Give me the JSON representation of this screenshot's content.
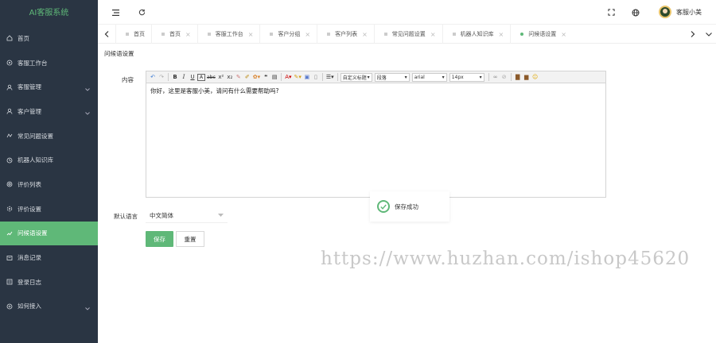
{
  "brand": "AI客服系统",
  "sidebar": {
    "items": [
      {
        "label": "首页",
        "icon": "home-icon",
        "chevron": false
      },
      {
        "label": "客服工作台",
        "icon": "workbench-icon",
        "chevron": false
      },
      {
        "label": "客服管理",
        "icon": "user-icon",
        "chevron": true
      },
      {
        "label": "客户管理",
        "icon": "user-icon",
        "chevron": true
      },
      {
        "label": "常见问题设置",
        "icon": "question-icon",
        "chevron": false
      },
      {
        "label": "机器人知识库",
        "icon": "robot-icon",
        "chevron": false
      },
      {
        "label": "评价列表",
        "icon": "rating-icon",
        "chevron": false
      },
      {
        "label": "评价设置",
        "icon": "settings-icon",
        "chevron": false
      },
      {
        "label": "问候语设置",
        "icon": "greeting-icon",
        "chevron": false,
        "active": true
      },
      {
        "label": "消息记录",
        "icon": "message-icon",
        "chevron": false
      },
      {
        "label": "登录日志",
        "icon": "log-icon",
        "chevron": false
      },
      {
        "label": "如何接入",
        "icon": "connect-icon",
        "chevron": true
      }
    ]
  },
  "header": {
    "user_name": "客服小美"
  },
  "tabs": [
    {
      "label": "首页",
      "closable": false
    },
    {
      "label": "首页",
      "closable": true
    },
    {
      "label": "客服工作台",
      "closable": true
    },
    {
      "label": "客户分组",
      "closable": true
    },
    {
      "label": "客户列表",
      "closable": true
    },
    {
      "label": "常见问题设置",
      "closable": true
    },
    {
      "label": "机器人知识库",
      "closable": true
    },
    {
      "label": "问候语设置",
      "closable": true,
      "active": true
    }
  ],
  "page": {
    "title": "问候语设置",
    "content_label": "内容",
    "editor_text": "你好，这里是客服小美，请问有什么需要帮助吗?",
    "toolbar": {
      "style_select": "自定义标题",
      "para_select": "段落",
      "font_select": "arial",
      "size_select": "14px"
    },
    "lang_label": "默认语言",
    "lang_value": "中文简体",
    "save_label": "保存",
    "reset_label": "重置"
  },
  "toast": {
    "text": "保存成功"
  },
  "watermark": "https://www.huzhan.com/ishop45620",
  "colors": {
    "sidebar_bg": "#2a3543",
    "accent": "#5fb878"
  }
}
